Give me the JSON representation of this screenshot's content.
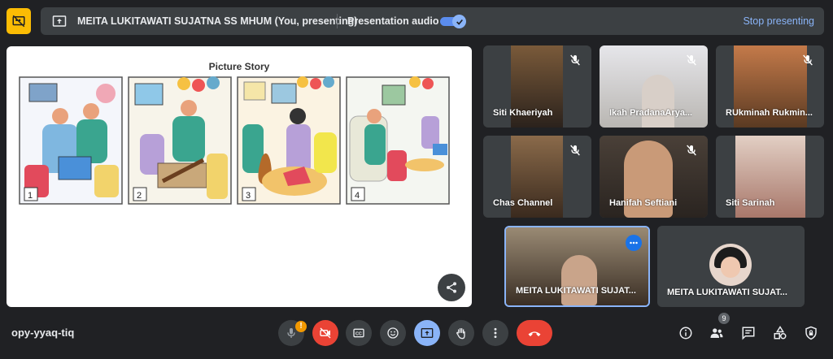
{
  "presentation_bar": {
    "title": "MEITA LUKITAWATI SUJATNA SS MHUM (You, presenting)",
    "audio_label": "Presentation audio",
    "audio_enabled": true,
    "stop_label": "Stop presenting"
  },
  "slide": {
    "title": "Picture Story",
    "panel_numbers": [
      "1",
      "2",
      "3",
      "4"
    ]
  },
  "participants": [
    {
      "name": "Siti Khaeriyah",
      "muted": true
    },
    {
      "name": "Ikah PradanaArya...",
      "muted": true
    },
    {
      "name": "RUkminah Rukmin...",
      "muted": true
    },
    {
      "name": "Chas Channel",
      "muted": true
    },
    {
      "name": "Hanifah Seftiani",
      "muted": true
    },
    {
      "name": "Siti Sarinah",
      "muted": false
    },
    {
      "name": "MEITA LUKITAWATI SUJAT...",
      "muted": false
    },
    {
      "name": "MEITA LUKITAWATI SUJAT...",
      "muted": false
    }
  ],
  "bottom_bar": {
    "meeting_code": "opy-yyaq-tiq",
    "mic_warning": "!",
    "people_count": "9",
    "icons": [
      "mic-icon",
      "camera-off-icon",
      "captions-icon",
      "emoji-icon",
      "present-icon",
      "raise-hand-icon",
      "more-options-icon",
      "end-call-icon",
      "info-icon",
      "people-icon",
      "chat-icon",
      "activities-icon",
      "host-controls-icon"
    ]
  },
  "colors": {
    "background": "#202124",
    "surface": "#3c4043",
    "accent": "#8ab4f8",
    "danger": "#ea4335",
    "warning": "#fbbc04"
  }
}
